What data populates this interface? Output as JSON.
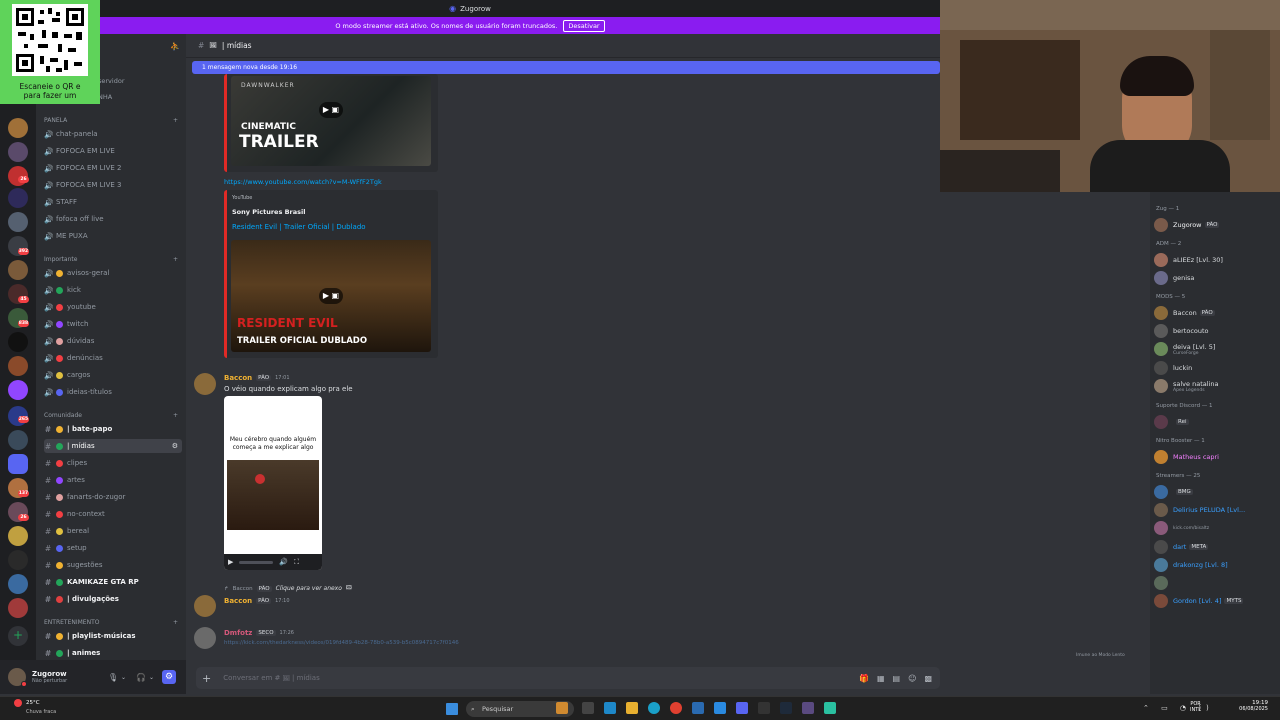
{
  "window": {
    "title": "Zugorow"
  },
  "streamer_banner": {
    "text": "O modo streamer está ativo. Os nomes de usuário foram truncados.",
    "button": "Desativar"
  },
  "qr": {
    "text_line1": "Escaneie o QR e",
    "text_line2": "para fazer um"
  },
  "server": {
    "line1": "servidor",
    "line2": "NHA"
  },
  "channel_header": {
    "name": "| mídias"
  },
  "new_messages_bar": "1 mensagem nova desde 19:16",
  "categories": {
    "panela": "PANELA",
    "importante": "Importante",
    "comunidade": "Comunidade",
    "entretenimento": "ENTRETENIMENTO"
  },
  "channels_panela": [
    "chat-panela",
    "FOFOCA EM LIVE",
    "FOFOCA EM LIVE 2",
    "FOFOCA EM LIVE 3",
    "STAFF",
    "fofoca off live",
    "ME PUXA"
  ],
  "channels_importante": [
    "avisos-geral",
    "kick",
    "youtube",
    "twitch",
    "dúvidas",
    "denúncias",
    "cargos",
    "ideias-títulos"
  ],
  "channels_comunidade": [
    "| bate-papo",
    "| mídias",
    "clipes",
    "artes",
    "fanarts-do-zugor",
    "no-context",
    "bereal",
    "setup",
    "sugestões",
    "KAMIKAZE GTA RP",
    "| divulgações"
  ],
  "channels_entretenimento": [
    "| playlist-músicas",
    "| animes"
  ],
  "user": {
    "name": "Zugorow",
    "status": "Não perturbar"
  },
  "messages": {
    "embed1": {
      "game": "DAWNWALKER",
      "line1": "CINEMATIC",
      "line2": "TRAILER"
    },
    "link1": "https://www.youtube.com/watch?v=M-WFfF2Tgk",
    "embed2": {
      "provider": "YouTube",
      "author": "Sony Pictures Brasil",
      "title": "Resident Evil | Trailer Oficial | Dublado",
      "thumb_line1": "RESIDENT EVIL",
      "thumb_line2": "TRAILER OFICIAL DUBLADO"
    },
    "msg1": {
      "author": "Baccon",
      "tag": "PÃO",
      "time": "17:01",
      "text": "O véio quando explicam algo pra ele",
      "meme_caption": "Meu cérebro quando alguém começa a me explicar algo"
    },
    "reply": {
      "author": "Baccon",
      "tag": "PÃO",
      "text": "Clique para ver anexo"
    },
    "msg2": {
      "author": "Baccon",
      "tag": "PÃO",
      "time": "17:10"
    },
    "msg3": {
      "author": "Dmfotz",
      "tag": "SECO",
      "time": "17:26",
      "link": "https://kick.com/thedarkness/videos/019fd489-4b28-78b0-a539-b5c0894717c7f0146"
    }
  },
  "typing_hint": "Imune ao Modo Lento",
  "composer_placeholder": "Conversar em #",
  "members": {
    "groups": [
      {
        "title": "Zug — 1",
        "items": [
          {
            "name": "Zugorow",
            "tag": "PÃO"
          }
        ]
      },
      {
        "title": "ADM — 2",
        "items": [
          {
            "name": "aLIEEz [Lvl. 30]"
          },
          {
            "name": "genisa"
          }
        ]
      },
      {
        "title": "MODS — 5",
        "items": [
          {
            "name": "Baccon",
            "tag": "PÃO"
          },
          {
            "name": "bertocouto"
          },
          {
            "name": "deiva [Lvl. 5]",
            "sub": "CurseForge"
          },
          {
            "name": "luckin"
          },
          {
            "name": "salve natalina",
            "sub": "Apex Legends"
          }
        ]
      },
      {
        "title": "Suporte Discord — 1",
        "items": [
          {
            "name": "",
            "tag": "Rei"
          }
        ]
      },
      {
        "title": "Nitro Booster — 1",
        "items": [
          {
            "name": "Matheus capri"
          }
        ]
      },
      {
        "title": "Streamers — 25",
        "items": [
          {
            "name": "",
            "tag": "BMG"
          },
          {
            "name": "Delirius PELUDA [Lvl..."
          },
          {
            "name": "",
            "sub": "kick.com/bisaltz"
          },
          {
            "name": "dart",
            "tag": "META"
          },
          {
            "name": "drakonzg [Lvl. 8]"
          },
          {
            "name": ""
          },
          {
            "name": "Gordon [Lvl. 4]",
            "tag": "MYTS"
          }
        ]
      }
    ]
  },
  "taskbar": {
    "weather_temp": "25°C",
    "weather_text": "Chuva fraca",
    "search": "Pesquisar",
    "lang": "POR",
    "lang2": "INTL",
    "time": "19:19",
    "date": "06/08/2025"
  }
}
